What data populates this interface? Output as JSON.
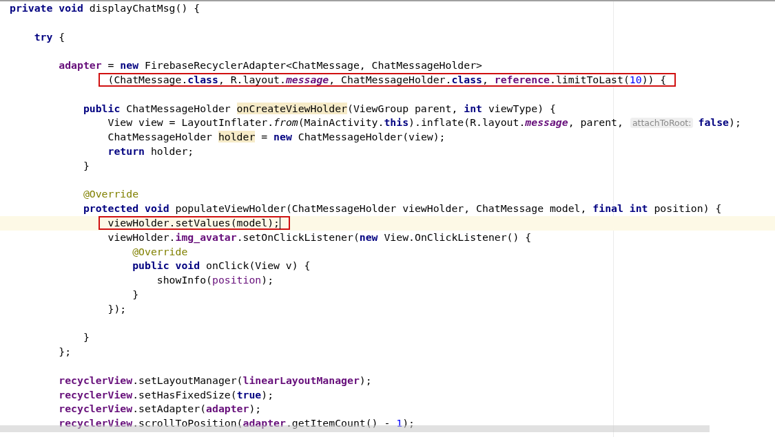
{
  "editor": {
    "lines": [
      {
        "kind": "code",
        "current": false,
        "framed": false,
        "tokens": [
          {
            "text": "private",
            "kind": "kw"
          },
          {
            "text": " void",
            "kind": "kw"
          },
          {
            "text": " displayChatMsg() {",
            "kind": "plain"
          }
        ],
        "children": [
          {
            "kind": "blank"
          },
          {
            "kind": "code",
            "current": false,
            "framed": false,
            "tokens": [
              {
                "text": "try",
                "kind": "kw"
              },
              {
                "text": " {",
                "kind": "plain"
              }
            ],
            "children": [
              {
                "kind": "blank"
              },
              {
                "kind": "code",
                "current": false,
                "framed": false,
                "tokens": [
                  {
                    "text": "adapter",
                    "kind": "field"
                  },
                  {
                    "text": " = ",
                    "kind": "plain"
                  },
                  {
                    "text": "new",
                    "kind": "kw"
                  },
                  {
                    "text": " FirebaseRecyclerAdapter<ChatMessage, ChatMessageHolder>",
                    "kind": "plain"
                  }
                ],
                "children": [
                  {
                    "kind": "continuation",
                    "current": false,
                    "framed": true,
                    "tokens": [
                      {
                        "text": "(ChatMessage.",
                        "kind": "plain"
                      },
                      {
                        "text": "class",
                        "kind": "kw"
                      },
                      {
                        "text": ", R.layout.",
                        "kind": "plain"
                      },
                      {
                        "text": "message",
                        "kind": "static"
                      },
                      {
                        "text": ", ChatMessageHolder.",
                        "kind": "plain"
                      },
                      {
                        "text": "class",
                        "kind": "kw"
                      },
                      {
                        "text": ", ",
                        "kind": "plain"
                      },
                      {
                        "text": "reference",
                        "kind": "field"
                      },
                      {
                        "text": ".limitToLast(",
                        "kind": "plain"
                      },
                      {
                        "text": "10",
                        "kind": "num"
                      },
                      {
                        "text": ")) {",
                        "kind": "plain"
                      }
                    ]
                  },
                  {
                    "kind": "blank"
                  },
                  {
                    "kind": "code",
                    "current": false,
                    "framed": false,
                    "tokens": [
                      {
                        "text": "public",
                        "kind": "kw"
                      },
                      {
                        "text": " ChatMessageHolder ",
                        "kind": "plain"
                      },
                      {
                        "text": "onCreateViewHolder",
                        "kind": "usage"
                      },
                      {
                        "text": "(ViewGroup parent, ",
                        "kind": "plain"
                      },
                      {
                        "text": "int",
                        "kind": "kw"
                      },
                      {
                        "text": " viewType) {",
                        "kind": "plain"
                      }
                    ],
                    "children": [
                      {
                        "kind": "code",
                        "current": false,
                        "framed": false,
                        "tokens": [
                          {
                            "text": "View view = LayoutInflater.",
                            "kind": "plain"
                          },
                          {
                            "text": "from",
                            "kind": "italic"
                          },
                          {
                            "text": "(MainActivity.",
                            "kind": "plain"
                          },
                          {
                            "text": "this",
                            "kind": "kw"
                          },
                          {
                            "text": ").inflate(R.layout.",
                            "kind": "plain"
                          },
                          {
                            "text": "message",
                            "kind": "static"
                          },
                          {
                            "text": ", parent,",
                            "kind": "plain"
                          },
                          {
                            "text": "attachToRoot:",
                            "kind": "hint"
                          },
                          {
                            "text": "false",
                            "kind": "kw"
                          },
                          {
                            "text": ");",
                            "kind": "plain"
                          }
                        ]
                      },
                      {
                        "kind": "code",
                        "current": false,
                        "framed": false,
                        "tokens": [
                          {
                            "text": "ChatMessageHolder ",
                            "kind": "plain"
                          },
                          {
                            "text": "holder",
                            "kind": "usage"
                          },
                          {
                            "text": " = ",
                            "kind": "plain"
                          },
                          {
                            "text": "new",
                            "kind": "kw"
                          },
                          {
                            "text": " ChatMessageHolder(view);",
                            "kind": "plain"
                          }
                        ]
                      },
                      {
                        "kind": "code",
                        "current": false,
                        "framed": false,
                        "tokens": [
                          {
                            "text": "return",
                            "kind": "kw"
                          },
                          {
                            "text": " holder;",
                            "kind": "plain"
                          }
                        ]
                      }
                    ]
                  },
                  {
                    "kind": "code",
                    "current": false,
                    "framed": false,
                    "tokens": [
                      {
                        "text": "}",
                        "kind": "plain"
                      }
                    ]
                  },
                  {
                    "kind": "blank"
                  },
                  {
                    "kind": "code",
                    "current": false,
                    "framed": false,
                    "tokens": [
                      {
                        "text": "@Override",
                        "kind": "annotation"
                      }
                    ]
                  },
                  {
                    "kind": "code",
                    "current": false,
                    "framed": false,
                    "tokens": [
                      {
                        "text": "protected",
                        "kind": "kw"
                      },
                      {
                        "text": " void",
                        "kind": "kw"
                      },
                      {
                        "text": " populateViewHolder(ChatMessageHolder viewHolder, ChatMessage model, ",
                        "kind": "plain"
                      },
                      {
                        "text": "final",
                        "kind": "kw"
                      },
                      {
                        "text": " int",
                        "kind": "kw"
                      },
                      {
                        "text": " position) {",
                        "kind": "plain"
                      }
                    ],
                    "children": [
                      {
                        "kind": "code",
                        "current": true,
                        "framed": true,
                        "tokens": [
                          {
                            "text": "viewHolder.setValues(model);",
                            "kind": "plain"
                          }
                        ]
                      },
                      {
                        "kind": "code",
                        "current": false,
                        "framed": false,
                        "tokens": [
                          {
                            "text": "viewHolder.",
                            "kind": "plain"
                          },
                          {
                            "text": "img_avatar",
                            "kind": "field"
                          },
                          {
                            "text": ".setOnClickListener(",
                            "kind": "plain"
                          },
                          {
                            "text": "new",
                            "kind": "kw"
                          },
                          {
                            "text": " View.OnClickListener() {",
                            "kind": "plain"
                          }
                        ],
                        "children": [
                          {
                            "kind": "code",
                            "current": false,
                            "framed": false,
                            "tokens": [
                              {
                                "text": "@Override",
                                "kind": "annotation"
                              }
                            ]
                          },
                          {
                            "kind": "code",
                            "current": false,
                            "framed": false,
                            "tokens": [
                              {
                                "text": "public",
                                "kind": "kw"
                              },
                              {
                                "text": " void",
                                "kind": "kw"
                              },
                              {
                                "text": " onClick(View v) {",
                                "kind": "plain"
                              }
                            ],
                            "children": [
                              {
                                "kind": "code",
                                "current": false,
                                "framed": false,
                                "tokens": [
                                  {
                                    "text": "showInfo(",
                                    "kind": "plain"
                                  },
                                  {
                                    "text": "position",
                                    "kind": "param"
                                  },
                                  {
                                    "text": ");",
                                    "kind": "plain"
                                  }
                                ]
                              }
                            ]
                          },
                          {
                            "kind": "code",
                            "current": false,
                            "framed": false,
                            "tokens": [
                              {
                                "text": "}",
                                "kind": "plain"
                              }
                            ]
                          }
                        ]
                      },
                      {
                        "kind": "code",
                        "current": false,
                        "framed": false,
                        "tokens": [
                          {
                            "text": "});",
                            "kind": "plain"
                          }
                        ]
                      }
                    ]
                  },
                  {
                    "kind": "blank"
                  },
                  {
                    "kind": "code",
                    "current": false,
                    "framed": false,
                    "tokens": [
                      {
                        "text": "}",
                        "kind": "plain"
                      }
                    ]
                  }
                ]
              },
              {
                "kind": "code",
                "current": false,
                "framed": false,
                "tokens": [
                  {
                    "text": "};",
                    "kind": "plain"
                  }
                ]
              },
              {
                "kind": "blank"
              },
              {
                "kind": "code",
                "current": false,
                "framed": false,
                "tokens": [
                  {
                    "text": "recyclerView",
                    "kind": "field"
                  },
                  {
                    "text": ".setLayoutManager(",
                    "kind": "plain"
                  },
                  {
                    "text": "linearLayoutManager",
                    "kind": "field"
                  },
                  {
                    "text": ");",
                    "kind": "plain"
                  }
                ]
              },
              {
                "kind": "code",
                "current": false,
                "framed": false,
                "tokens": [
                  {
                    "text": "recyclerView",
                    "kind": "field"
                  },
                  {
                    "text": ".setHasFixedSize(",
                    "kind": "plain"
                  },
                  {
                    "text": "true",
                    "kind": "kw"
                  },
                  {
                    "text": ");",
                    "kind": "plain"
                  }
                ]
              },
              {
                "kind": "code",
                "current": false,
                "framed": false,
                "tokens": [
                  {
                    "text": "recyclerView",
                    "kind": "field"
                  },
                  {
                    "text": ".setAdapter(",
                    "kind": "plain"
                  },
                  {
                    "text": "adapter",
                    "kind": "field"
                  },
                  {
                    "text": ");",
                    "kind": "plain"
                  }
                ]
              },
              {
                "kind": "code",
                "current": false,
                "framed": false,
                "tokens": [
                  {
                    "text": "recyclerView",
                    "kind": "field"
                  },
                  {
                    "text": ".scrollToPosition(",
                    "kind": "plain"
                  },
                  {
                    "text": "adapter",
                    "kind": "field"
                  },
                  {
                    "text": ".getItemCount() - ",
                    "kind": "plain"
                  },
                  {
                    "text": "1",
                    "kind": "num"
                  },
                  {
                    "text": ");",
                    "kind": "plain"
                  }
                ]
              }
            ]
          }
        ]
      }
    ]
  }
}
